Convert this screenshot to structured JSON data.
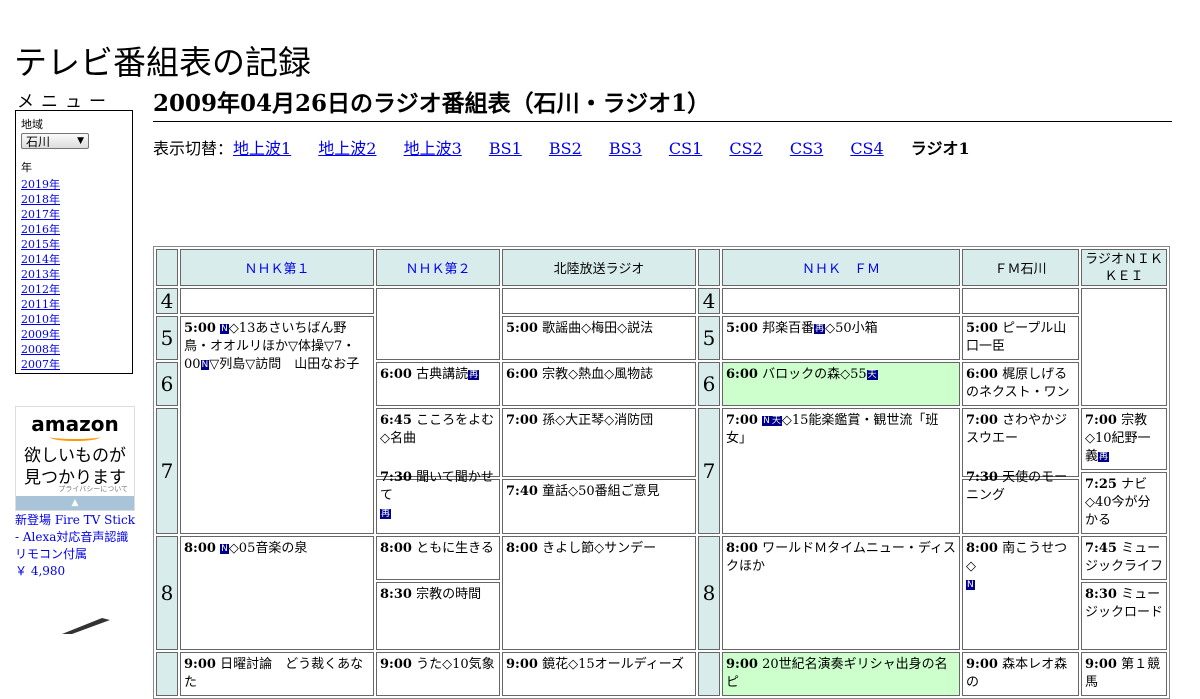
{
  "site_title": "テレビ番組表の記録",
  "menu": {
    "title": "メニュー",
    "region_label": "地域",
    "region_value": "石川",
    "year_label": "年",
    "years": [
      "2019年",
      "2018年",
      "2017年",
      "2016年",
      "2015年",
      "2014年",
      "2013年",
      "2012年",
      "2011年",
      "2010年",
      "2009年",
      "2008年",
      "2007年"
    ]
  },
  "ad": {
    "logo": "amazon",
    "copy1": "欲しいものが",
    "copy2": "見つかります",
    "privacy": "プライバシーについて",
    "product": "新登場 Fire TV Stick - Alexa対応音声認識リモコン付属",
    "price": "￥ 4,980"
  },
  "page_title": "2009年04月26日のラジオ番組表（石川・ラジオ1）",
  "switch": {
    "label": "表示切替：",
    "links": [
      "地上波1",
      "地上波2",
      "地上波3",
      "BS1",
      "BS2",
      "BS3",
      "CS1",
      "CS2",
      "CS3",
      "CS4"
    ],
    "current": "ラジオ1"
  },
  "channels": {
    "nhk1": "ＮＨＫ第１",
    "nhk2": "ＮＨＫ第２",
    "hokuriku": "北陸放送ラジオ",
    "nhkfm": "ＮＨＫ　ＦＭ",
    "fmishikawa": "ＦＭ石川",
    "nikkei": "ラジオＮＩＫＫＥＩ"
  },
  "hours": [
    "4",
    "5",
    "6",
    "7",
    "8"
  ],
  "badges": {
    "n": "N",
    "re": "再",
    "ten": "天"
  },
  "programs": {
    "nhk1_500": {
      "time": "5:00",
      "text": "◇13あさいちばん野鳥・オオルリほか▽体操▽7・00",
      "text2": "▽列島▽訪問　山田なお子"
    },
    "nhk1_800": {
      "time": "8:00",
      "text": "◇05音楽の泉"
    },
    "nhk1_900": {
      "time": "9:00",
      "text": "日曜討論　どう裁くあなた"
    },
    "nhk2_600": {
      "time": "6:00",
      "text": "古典講読"
    },
    "nhk2_645": {
      "time": "6:45",
      "text": "こころをよむ◇名曲"
    },
    "nhk2_730": {
      "time": "7:30",
      "text": "聞いて聞かせて"
    },
    "nhk2_800": {
      "time": "8:00",
      "text": "ともに生きる"
    },
    "nhk2_830": {
      "time": "8:30",
      "text": "宗教の時間"
    },
    "nhk2_900": {
      "time": "9:00",
      "text": "うた◇10気象"
    },
    "hk_500": {
      "time": "5:00",
      "text": "歌謡曲◇梅田◇説法"
    },
    "hk_600": {
      "time": "6:00",
      "text": "宗教◇熱血◇風物誌"
    },
    "hk_700": {
      "time": "7:00",
      "text": "孫◇大正琴◇消防団"
    },
    "hk_740": {
      "time": "7:40",
      "text": "童話◇50番組ご意見"
    },
    "hk_800": {
      "time": "8:00",
      "text": "きよし節◇サンデー"
    },
    "hk_900": {
      "time": "9:00",
      "text": "鏡花◇15オールディーズ"
    },
    "fm_500": {
      "time": "5:00",
      "text": "邦楽百番",
      "text2": "◇50小箱"
    },
    "fm_600": {
      "time": "6:00",
      "text": "バロックの森◇55"
    },
    "fm_700": {
      "time": "7:00",
      "text": "◇15能楽鑑賞・観世流「班女」"
    },
    "fm_800": {
      "time": "8:00",
      "text": "ワールドＭタイムニュー・ディスクほか"
    },
    "fm_900": {
      "time": "9:00",
      "text": "20世紀名演奏ギリシャ出身の名ピ"
    },
    "fmi_500": {
      "time": "5:00",
      "text": "ピープル山口一臣"
    },
    "fmi_600": {
      "time": "6:00",
      "text": "梶原しげるのネクスト・ワン"
    },
    "fmi_700": {
      "time": "7:00",
      "text": "さわやかジスウエー"
    },
    "fmi_730": {
      "time": "7:30",
      "text": "天使のモーニング"
    },
    "fmi_800": {
      "time": "8:00",
      "text": "南こうせつ◇"
    },
    "fmi_900": {
      "time": "9:00",
      "text": "森本レオ森の"
    },
    "nk_700": {
      "time": "7:00",
      "text": "宗教◇10紀野一義"
    },
    "nk_725": {
      "time": "7:25",
      "text": "ナビ◇40今が分かる"
    },
    "nk_745": {
      "time": "7:45",
      "text": "ミュージックライフ"
    },
    "nk_830": {
      "time": "8:30",
      "text": "ミュージックロード"
    },
    "nk_900": {
      "time": "9:00",
      "text": "第１競馬"
    }
  },
  "colors": {
    "header_bg": "#d8ecec",
    "highlight_bg": "#ccffcc",
    "link": "#0000ee",
    "badge_bg": "#00008b"
  }
}
